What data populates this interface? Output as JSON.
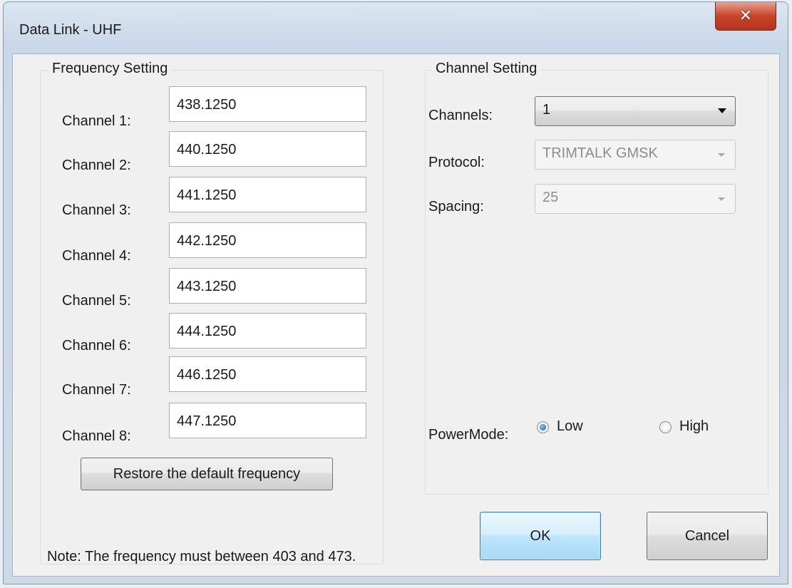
{
  "window": {
    "title": "Data Link - UHF",
    "close_symbol": "✕"
  },
  "frequency_setting": {
    "legend": "Frequency Setting",
    "channels": [
      {
        "label": "Channel 1:",
        "value": "438.1250"
      },
      {
        "label": "Channel 2:",
        "value": "440.1250"
      },
      {
        "label": "Channel 3:",
        "value": "441.1250"
      },
      {
        "label": "Channel 4:",
        "value": "442.1250"
      },
      {
        "label": "Channel 5:",
        "value": "443.1250"
      },
      {
        "label": "Channel 6:",
        "value": "444.1250"
      },
      {
        "label": "Channel 7:",
        "value": "446.1250"
      },
      {
        "label": "Channel 8:",
        "value": "447.1250"
      }
    ],
    "restore_label": "Restore the default frequency"
  },
  "channel_setting": {
    "legend": "Channel Setting",
    "channels_label": "Channels:",
    "channels_value": "1",
    "protocol_label": "Protocol:",
    "protocol_value": "TRIMTALK GMSK",
    "spacing_label": "Spacing:",
    "spacing_value": "25",
    "powermode_label": "PowerMode:",
    "power_low_label": "Low",
    "power_high_label": "High",
    "power_selected": "Low"
  },
  "footer": {
    "note": "Note: The frequency must between 403 and 473.",
    "ok_label": "OK",
    "cancel_label": "Cancel"
  }
}
